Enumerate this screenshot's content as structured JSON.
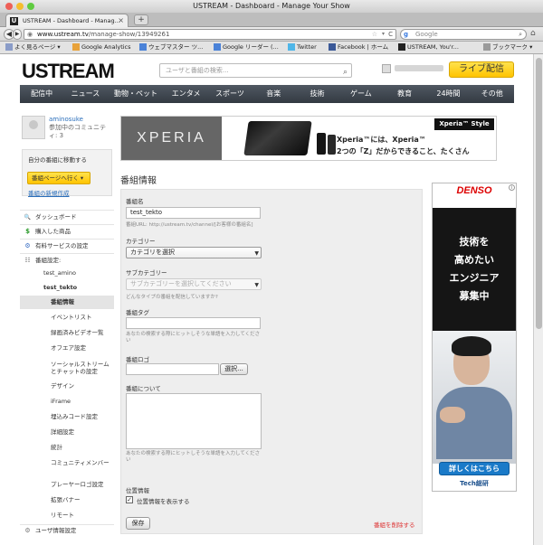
{
  "window": {
    "title": "USTREAM - Dashboard - Manage Your Show"
  },
  "tab": {
    "label": "USTREAM - Dashboard - Manag...",
    "close": "×",
    "new": "+"
  },
  "navigation": {
    "url_domain": "www.ustream.tv",
    "url_path": "/manage-show/13949261",
    "search_engine": "Google",
    "back": "◀",
    "forward": "▶",
    "reload": "C"
  },
  "bookmarks": [
    "よく見るページ ▾",
    "Google Analytics",
    "ウェブマスター ツ...",
    "Google リーダー (...",
    "Twitter",
    "Facebook | ホーム",
    "USTREAM, You'r...",
    "ブックマーク ▾"
  ],
  "site": {
    "logo": "USTREAM",
    "search_placeholder": "ユーザと番組の検索...",
    "live_button": "ライブ配信",
    "nav": [
      "配信中",
      "ニュース",
      "動物・ペット",
      "エンタメ",
      "スポーツ",
      "音楽",
      "技術",
      "ゲーム",
      "教育",
      "24時間",
      "その他"
    ]
  },
  "profile": {
    "name": "aminosuke",
    "community_count": "参加中のコミュニティ: 3"
  },
  "go_box": {
    "title": "自分の番組に移動する",
    "button": "番組ページへ行く ▾",
    "new_show": "番組の新規作成"
  },
  "sidebar": {
    "items": [
      {
        "label": "ダッシュボード",
        "icon": "magnifier-icon",
        "glyph": "🔍"
      },
      {
        "label": "購入した商品",
        "icon": "dollar-icon",
        "glyph": "$"
      },
      {
        "label": "有料サービスの設定",
        "icon": "gear-icon",
        "glyph": "⚙"
      },
      {
        "label": "番組設定:",
        "icon": "show-settings-icon",
        "glyph": "☷"
      }
    ],
    "shows": [
      "test_amino",
      "test_tekto"
    ],
    "subitems": [
      "番組情報",
      "イベントリスト",
      "録画済みビデオ一覧",
      "オフエア設定",
      "ソーシャルストリームとチャットの設定",
      "デザイン",
      "iFrame",
      "埋込みコード設定",
      "詳細設定",
      "統計",
      "コミュニティメンバー",
      "プレーヤーロゴ設定",
      "拡張バナー",
      "リモート"
    ],
    "user_settings": "ユーザ情報設定",
    "user_settings_icon": "user-gear-icon"
  },
  "banner": {
    "brand": "XPERIA",
    "tag": "Xperia™ Style",
    "copy_line1": "Xperia™には、Xperia™",
    "copy_line2": "2つの「Z」だからできること、たくさん"
  },
  "form": {
    "section_title": "番組情報",
    "name_label": "番組名",
    "name_value": "test_tekto",
    "url_hint": "番組URL: http://ustream.tv/channel/[お客様の番組名]",
    "category_label": "カテゴリー",
    "category_value": "カテゴリを選択",
    "subcategory_label": "サブカテゴリー",
    "subcategory_value": "サブカテゴリーを選択してください",
    "subcategory_hint": "どんなタイプの番組を配信していますか?",
    "tag_label": "番組タグ",
    "tag_hint": "あなたの検索する際にヒットしそうな単語を入力してくださ い",
    "logo_label": "番組ロゴ",
    "select_button": "選択...",
    "about_label": "番組について",
    "about_hint": "あなたの検索する際にヒットしそうな単語を入力してくださ い",
    "location_label": "位置情報",
    "location_checkbox_label": "位置情報を表示する",
    "location_checked": true,
    "save_button": "保存",
    "delete_link": "番組を削除する"
  },
  "ad": {
    "brand": "DENSO",
    "info": "i",
    "copy_lines": [
      "技術を",
      "高めたい",
      "エンジニア",
      "募集中"
    ],
    "button": "詳しくはこちら",
    "footer": "Tech総研"
  }
}
